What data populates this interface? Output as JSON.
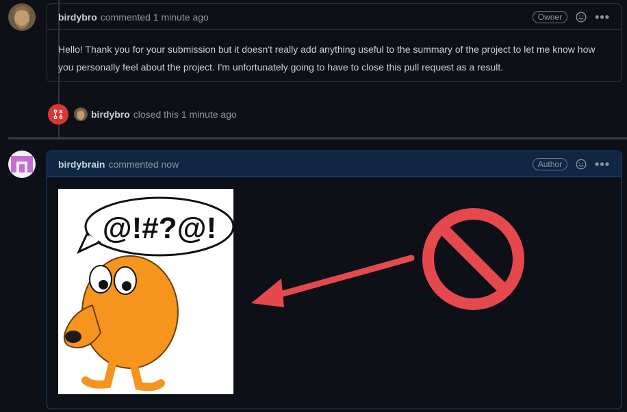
{
  "comment1": {
    "author": "birdybro",
    "meta": "commented 1 minute ago",
    "badge": "Owner",
    "text": "Hello! Thank you for your submission but it doesn't really add anything useful to the summary of the project to let me know how you personally feel about the project. I'm unfortunately going to have to close this pull request as a result."
  },
  "event": {
    "actor": "birdybro",
    "action": "closed this 1 minute ago"
  },
  "comment2": {
    "author": "birdybrain",
    "meta": "commented now",
    "badge": "Author",
    "speech": "@!#?@!"
  },
  "colors": {
    "background": "#0d1117",
    "border": "#30363d",
    "closed": "#da3633",
    "author_header": "#0f2744",
    "annotation": "#e5484d",
    "character": "#f7941d"
  },
  "icons": [
    "smiley-icon",
    "kebab-menu-icon",
    "pull-request-closed-icon",
    "prohibited-icon",
    "arrow-icon"
  ]
}
